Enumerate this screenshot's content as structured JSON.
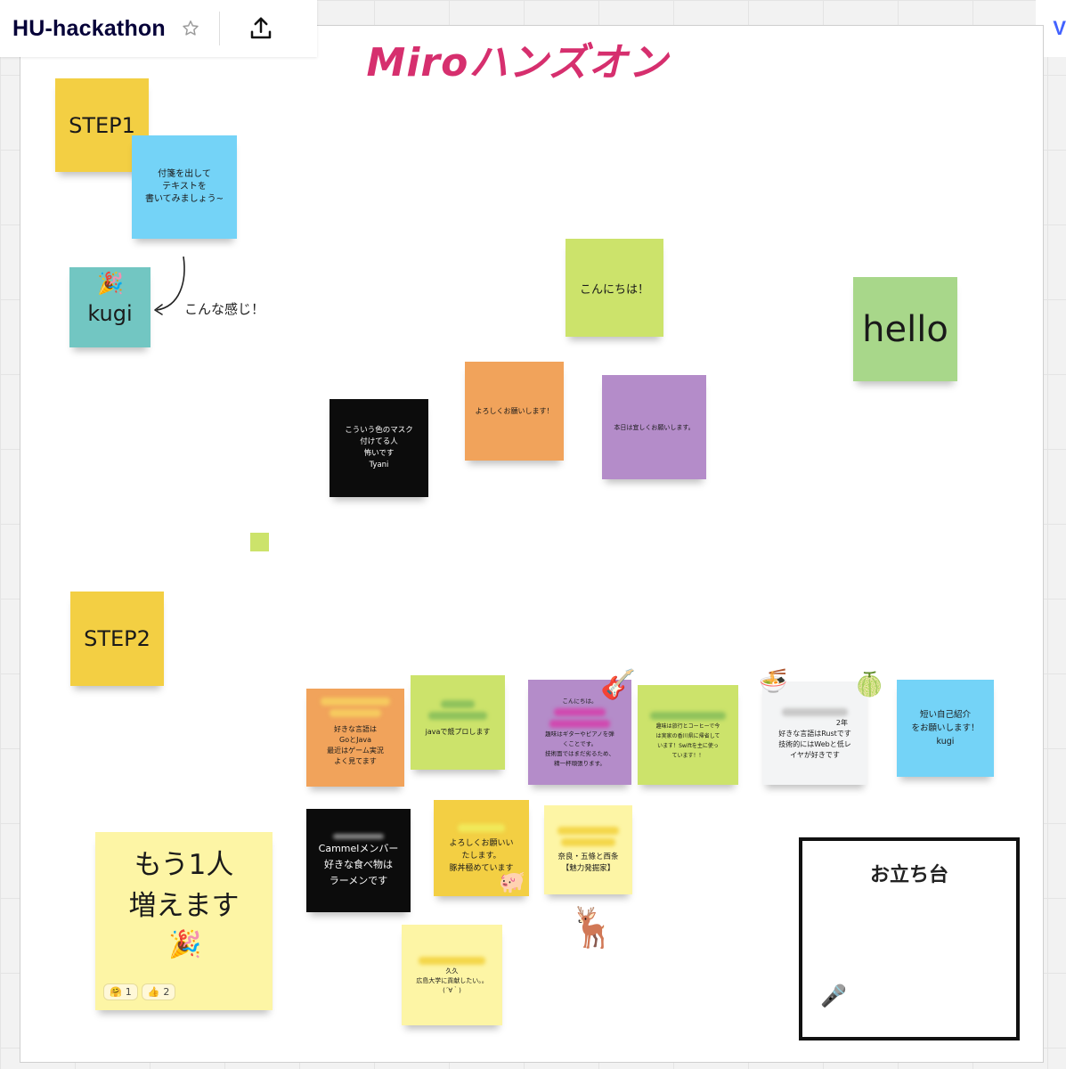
{
  "topbar": {
    "board_title": "HU-hackathon",
    "star_icon": "star-outline-icon",
    "upload_icon": "upload-icon",
    "right_stub": "V"
  },
  "frame": {
    "title": "Miroハンズオン"
  },
  "notes": {
    "step1": "STEP1",
    "step1_hint": [
      "付箋を出して",
      "テキストを",
      "書いてみましょう~"
    ],
    "kugi": "kugi",
    "annotation": "こんな感じ！",
    "konnichiwa": "こんにちは！",
    "hello": "hello",
    "yoroshiku": "よろしくお願いします！",
    "honjitsu": "本日は宜しくお願いします。",
    "mask": [
      "こういう色のマスク",
      "付けてる人",
      "怖いです",
      "Tyani"
    ],
    "step2": "STEP2",
    "gojava": [
      "好きな言語は",
      "GoとJava",
      "最近はゲーム実況",
      "よく見てます"
    ],
    "kyopro": "javaで競プロします",
    "guitar": [
      "こんにちは。",
      "趣味はギターやピアノを弾",
      "くことです。",
      "技術面ではまだ劣るため、",
      "精一杯頑張ります。"
    ],
    "travel": [
      "趣味は旅行とコーヒーで今",
      "は実家の香川県に帰省して",
      "います！Swiftを主に使っ",
      "ています！！"
    ],
    "rust": [
      "2年",
      "好きな言語はRustです",
      "技術的にはWebと低レ",
      "イヤが好きです"
    ],
    "short_intro": [
      "短い自己紹介",
      "をお願いします！",
      "kugi"
    ],
    "cammel": [
      "Cammelメンバー",
      "好きな食べ物は",
      "ラーメンです"
    ],
    "butadon": [
      "よろしくお願いい",
      "たします。",
      "豚丼極めています"
    ],
    "nara": [
      "奈良・五條と西条",
      "【魅力発掘家】"
    ],
    "kyu": [
      "久久",
      "広島大学に貢献したい。。",
      "(´∀｀)"
    ],
    "mou_hitori": [
      "もう1人",
      "増えます"
    ]
  },
  "reactions": [
    {
      "icon": "hugging-face-emoji",
      "glyph": "🤗",
      "count": "1"
    },
    {
      "icon": "thumbs-up-emoji",
      "glyph": "👍",
      "count": "2"
    }
  ],
  "emoji_stickers": {
    "party": "🎉",
    "guitar": "🎸",
    "ramen": "🍜",
    "melon": "🍈",
    "pig": "🐖",
    "deer": "🦌",
    "mic": "🎤"
  },
  "podium": {
    "label": "お立ち台"
  },
  "colors": {
    "accent_title": "#d62f6e",
    "brand_blue": "#4262ff",
    "yellow_note": "#f3cf43",
    "blue_note": "#74d3f7",
    "teal_note": "#72c6c2",
    "lime_note": "#cce36b",
    "green_note": "#a8d78a",
    "orange_note": "#f1a35b",
    "purple_note": "#b48cc9",
    "black_note": "#0c0c0c",
    "pale_yellow_note": "#fdf5a5"
  }
}
